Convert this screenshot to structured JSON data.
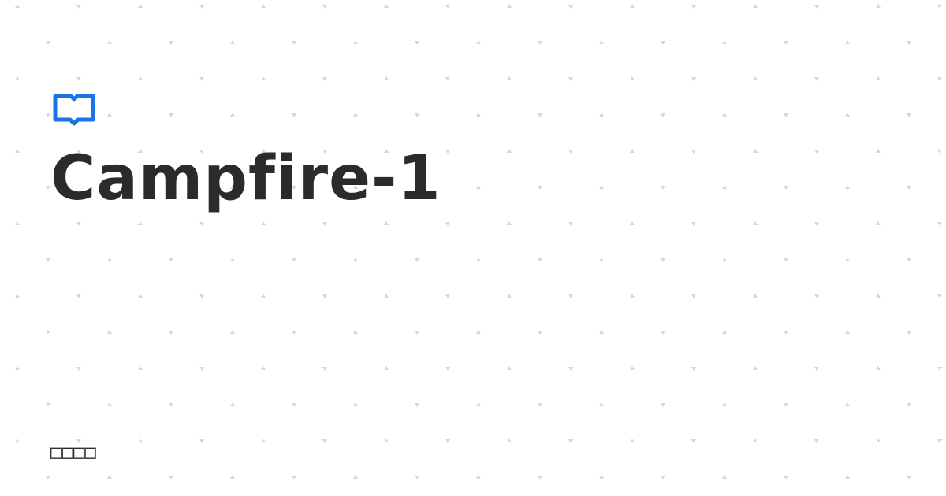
{
  "brand": {
    "icon": "open-book-icon",
    "accent_color": "#1a73e8"
  },
  "title": "Campfire-1",
  "footer_text": "□□□□",
  "background": {
    "pattern": "dotted-triangles",
    "pattern_color": "#d7d7d7",
    "background_color": "#ffffff"
  }
}
